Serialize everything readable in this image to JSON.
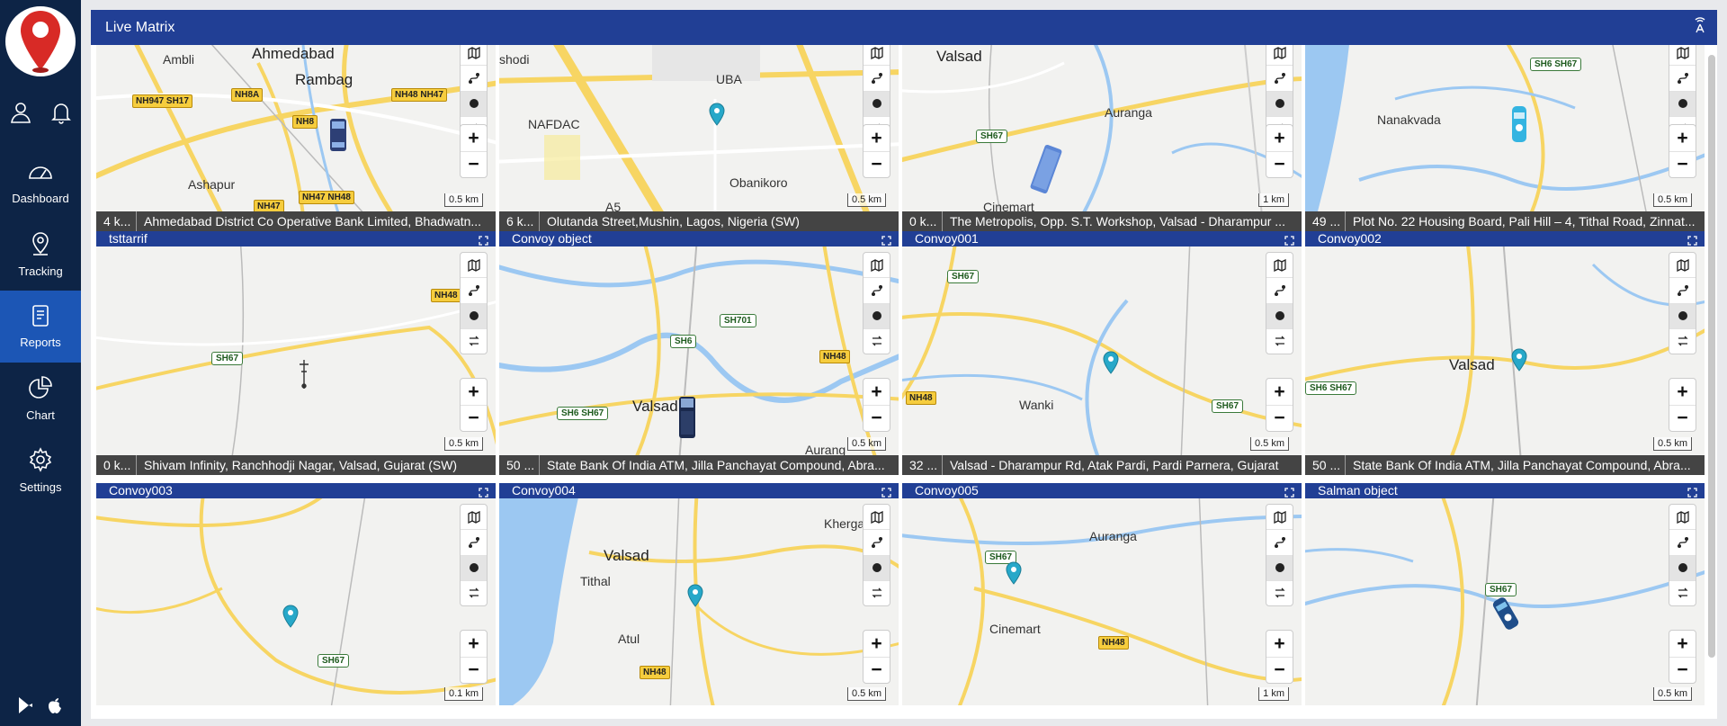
{
  "app": {
    "title": "Live Matrix"
  },
  "nav": {
    "items": [
      {
        "label": "Dashboard"
      },
      {
        "label": "Tracking"
      },
      {
        "label": "Reports"
      },
      {
        "label": "Chart"
      },
      {
        "label": "Settings"
      }
    ]
  },
  "tiles": [
    {
      "title": "",
      "speed": "4 k...",
      "address": "Ahmedabad District Co Operative Bank Limited, Bhadwatn...",
      "scale": "0.5 km"
    },
    {
      "title": "",
      "speed": "6 k...",
      "address": "Olutanda Street,Mushin, Lagos, Nigeria (SW)",
      "scale": "0.5 km"
    },
    {
      "title": "",
      "speed": "0 k...",
      "address": "The Metropolis, Opp. S.T. Workshop, Valsad - Dharampur ...",
      "scale": "1 km"
    },
    {
      "title": "",
      "speed": "49 ...",
      "address": "Plot No. 22 Housing Board, Pali Hill – 4, Tithal Road, Zinnat...",
      "scale": "0.5 km"
    },
    {
      "title": "tsttarrif",
      "speed": "0 k...",
      "address": "Shivam Infinity, Ranchhodji Nagar, Valsad, Gujarat (SW)",
      "scale": "0.5 km"
    },
    {
      "title": "Convoy object",
      "speed": "50 ...",
      "address": "State Bank Of India ATM, Jilla Panchayat Compound, Abra...",
      "scale": "0.5 km"
    },
    {
      "title": "Convoy001",
      "speed": "32 ...",
      "address": "Valsad - Dharampur Rd, Atak Pardi, Pardi Parnera, Gujarat",
      "scale": "0.5 km"
    },
    {
      "title": "Convoy002",
      "speed": "50 ...",
      "address": "State Bank Of India ATM, Jilla Panchayat Compound, Abra...",
      "scale": "0.5 km"
    },
    {
      "title": "Convoy003",
      "speed": "",
      "address": "",
      "scale": "0.1 km"
    },
    {
      "title": "Convoy004",
      "speed": "",
      "address": "",
      "scale": "0.5 km"
    },
    {
      "title": "Convoy005",
      "speed": "",
      "address": "",
      "scale": "1 km"
    },
    {
      "title": "Salman object",
      "speed": "",
      "address": "",
      "scale": "0.5 km"
    }
  ],
  "map_labels": {
    "t0": [
      "Ambli",
      "Ahmedabad",
      "Rambag",
      "Ashapur",
      "NH947 SH17",
      "NH8A",
      "NH48 NH47",
      "NH8",
      "NH47 NH48",
      "NH47"
    ],
    "t1": [
      "shodi",
      "UBA",
      "NAFDAC",
      "Obanikoro",
      "A5"
    ],
    "t2": [
      "Valsad",
      "Auranga",
      "SH67",
      "Cinemart"
    ],
    "t3": [
      "Nanakvada",
      "SH6 SH67"
    ],
    "t4": [
      "NH48",
      "SH67"
    ],
    "t5": [
      "SH701",
      "SH6",
      "NH48",
      "SH6 SH67",
      "Valsad",
      "Aurang"
    ],
    "t6": [
      "SH67",
      "NH48",
      "SH67",
      "Wanki"
    ],
    "t7": [
      "Valsad",
      "SH6 SH67"
    ],
    "t8": [
      "SH67"
    ],
    "t9": [
      "Valsad",
      "Tithal",
      "Atul",
      "NH48",
      "Khergam"
    ],
    "t10": [
      "Auranga",
      "SH67",
      "Cinemart",
      "NH48"
    ],
    "t11": [
      "SH67"
    ]
  },
  "icons": {
    "header_right": "broadcast-tower-icon",
    "tile_controls": [
      "map-layers-icon",
      "route-icon",
      "record-dot-icon",
      "swap-icon"
    ],
    "expand": "expand-icon"
  },
  "colors": {
    "sidebar": "#0d2446",
    "header": "#213f95",
    "active_nav": "#1c56b5",
    "water": "#9cc8f2",
    "road_major": "#f7d563",
    "pin": "#27a8c9"
  }
}
